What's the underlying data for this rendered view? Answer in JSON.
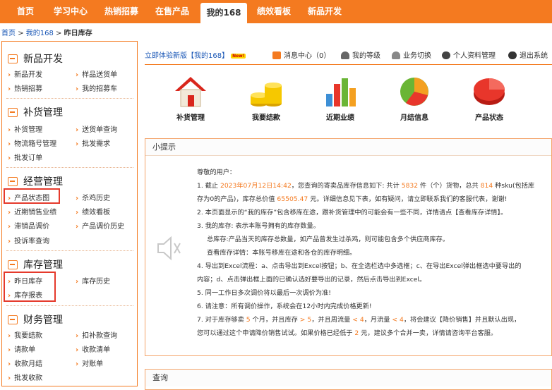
{
  "colors": {
    "accent": "#f47a20",
    "link": "#1a57b6",
    "highlight_box": "#e53a2c"
  },
  "nav": {
    "tabs": [
      "首页",
      "学习中心",
      "热销招募",
      "在售产品",
      "我的168",
      "绩效看板",
      "新品开发"
    ],
    "active": "我的168"
  },
  "breadcrumb": {
    "home": "首页",
    "my": "我的168",
    "current": "昨日库存",
    "sep": ">"
  },
  "sidebar": {
    "sections": [
      {
        "title": "新品开发",
        "icon": "new-product-icon",
        "items": [
          "新品开发",
          "样品送货单",
          "热销招募",
          "我的招募车"
        ]
      },
      {
        "title": "补货管理",
        "icon": "truck-icon",
        "items": [
          "补货管理",
          "送货单查询",
          "物流箱号管理",
          "批发需求",
          "批发订单"
        ]
      },
      {
        "title": "经营管理",
        "icon": "business-icon",
        "items": [
          "产品状态图",
          "杀鸡历史",
          "近期销售业绩",
          "绩效看板",
          "滞销品调价",
          "产品调价历史",
          "投诉率查询"
        ]
      },
      {
        "title": "库存管理",
        "icon": "inventory-icon",
        "items": [
          "昨日库存",
          "库存历史",
          "库存报表"
        ]
      },
      {
        "title": "财务管理",
        "icon": "yen-icon",
        "items": [
          "我要结款",
          "扣补款查询",
          "请款单",
          "收款清单",
          "收款月结",
          "对账单",
          "批发收款"
        ]
      }
    ]
  },
  "header": {
    "new_version": "立即体验新版【我的168】",
    "new_badge": "New!",
    "message_center": "消息中心（0）",
    "my_level": "我的等级",
    "switch_business": "业务切换",
    "profile": "个人资料管理",
    "logout": "退出系统"
  },
  "quick_icons": [
    "补货管理",
    "我要结款",
    "近期业绩",
    "月结信息",
    "产品状态"
  ],
  "tips": {
    "title": "小提示",
    "greeting": "尊敬的用户：",
    "l1a": "1. 截止",
    "date": "2023年07月12日14:42",
    "l1b": "，您查询的寄卖品库存信息如下: 共计",
    "count": "5832",
    "l1c": "件（个）货物，总共",
    "sku": "814",
    "l1d": "种sku(包括库",
    "l1e": "存为0的产品)，库存总价值",
    "value": "65505.47",
    "l1f": "元。详细信息见下表，如有疑问，请立即联系我们的客服代表，谢谢!",
    "l2": "2. 本页面显示的“我的库存”包含移库在途，跟补货管理中的可能会有一些不同，详情请点【查看库存详情】。",
    "l3": "3. 我的库存: 表示本账号拥有的库存数量。",
    "l3a": "总库存:产品当天的库存总数量，如产品曾发生过杀鸡，则可能包含多个供应商库存。",
    "l3b": "查看库存详情：本账号移库在途和各仓的库存明细。",
    "l4a": "4. 导出到Excel流程：a、点击导出到Excel按钮；b、在全选栏选中多选框；c、在导出Excel弹出框选中要导出的",
    "l4b": "内容；d、点击弹出框上面的已确认选好要导出的记录，然后点击导出到Excel。",
    "l5": "5. 同一工作日多次调价将以最后一次调价为准!",
    "l6": "6. 请注意：所有调价操作，系统会在12小时内完成价格更新!",
    "l7a": "7. 对于库存够卖",
    "n7a": "5",
    "l7b": "个月，并且库存",
    "n7b": "> 5",
    "l7c": "，并且周流量",
    "n7c": "< 4",
    "l7d": "，月流量",
    "n7d": "< 4",
    "l7e": "，将会建议【降价销售】并且默认出现，",
    "l7f": "您可以通过这个申请降价销售试试。如果价格已经低于",
    "n7e": "2",
    "l7g": "元，建议多个合并一卖，详情请咨询平台客服。"
  },
  "query": {
    "title": "查询"
  }
}
